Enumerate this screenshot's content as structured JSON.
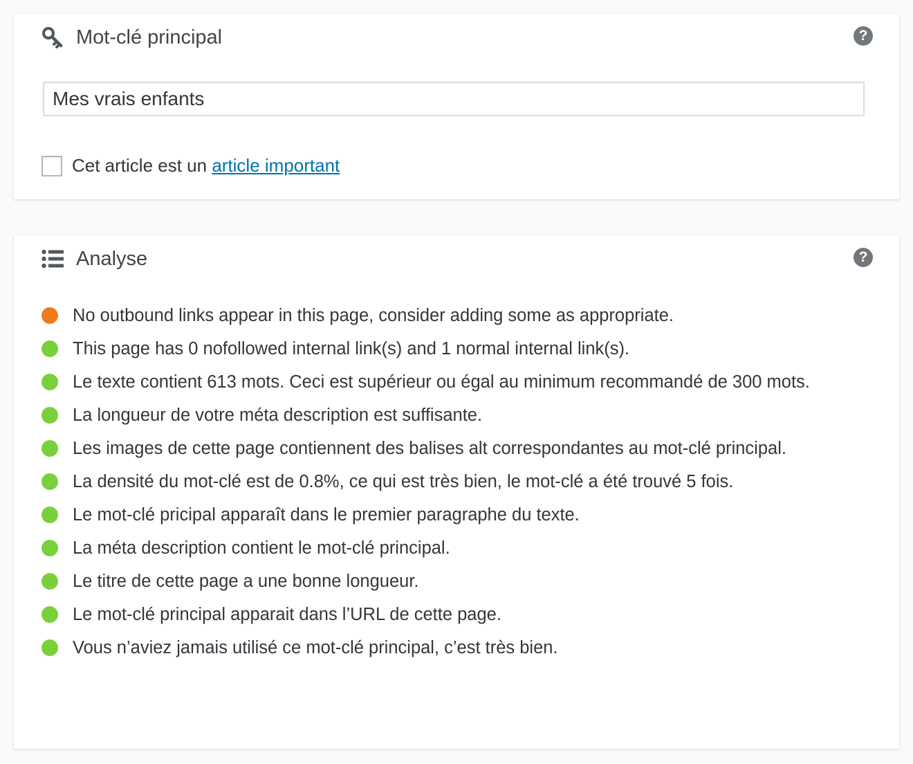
{
  "keyword_panel": {
    "title": "Mot-clé principal",
    "icon": "key-icon",
    "help_label": "?",
    "input_value": "Mes vrais enfants",
    "checkbox_label_prefix": "Cet article est un ",
    "checkbox_link": "article important",
    "checkbox_checked": false
  },
  "analysis_panel": {
    "title": "Analyse",
    "icon": "list-icon",
    "help_label": "?",
    "items": [
      {
        "status": "warning",
        "text": "No outbound links appear in this page, consider adding some as appropriate."
      },
      {
        "status": "good",
        "text": "This page has 0 nofollowed internal link(s) and 1 normal internal link(s)."
      },
      {
        "status": "good",
        "text": "Le texte contient 613 mots. Ceci est supérieur ou égal au minimum recommandé de 300 mots."
      },
      {
        "status": "good",
        "text": "La longueur de votre méta description est suffisante."
      },
      {
        "status": "good",
        "text": "Les images de cette page contiennent des balises alt correspondantes au mot-clé principal."
      },
      {
        "status": "good",
        "text": "La densité du mot-clé est de 0.8%, ce qui est très bien, le mot-clé a été trouvé 5 fois."
      },
      {
        "status": "good",
        "text": "Le mot-clé pricipal apparaît dans le premier paragraphe du texte."
      },
      {
        "status": "good",
        "text": "La méta description contient le mot-clé principal."
      },
      {
        "status": "good",
        "text": "Le titre de cette page a une bonne longueur."
      },
      {
        "status": "good",
        "text": "Le mot-clé principal apparait dans l’URL de cette page."
      },
      {
        "status": "good",
        "text": "Vous n’aviez jamais utilisé ce mot-clé principal, c’est très bien."
      }
    ]
  },
  "colors": {
    "good": "#7ad03a",
    "warning": "#ee7c1b",
    "link": "#0073aa",
    "help": "#72777c"
  }
}
